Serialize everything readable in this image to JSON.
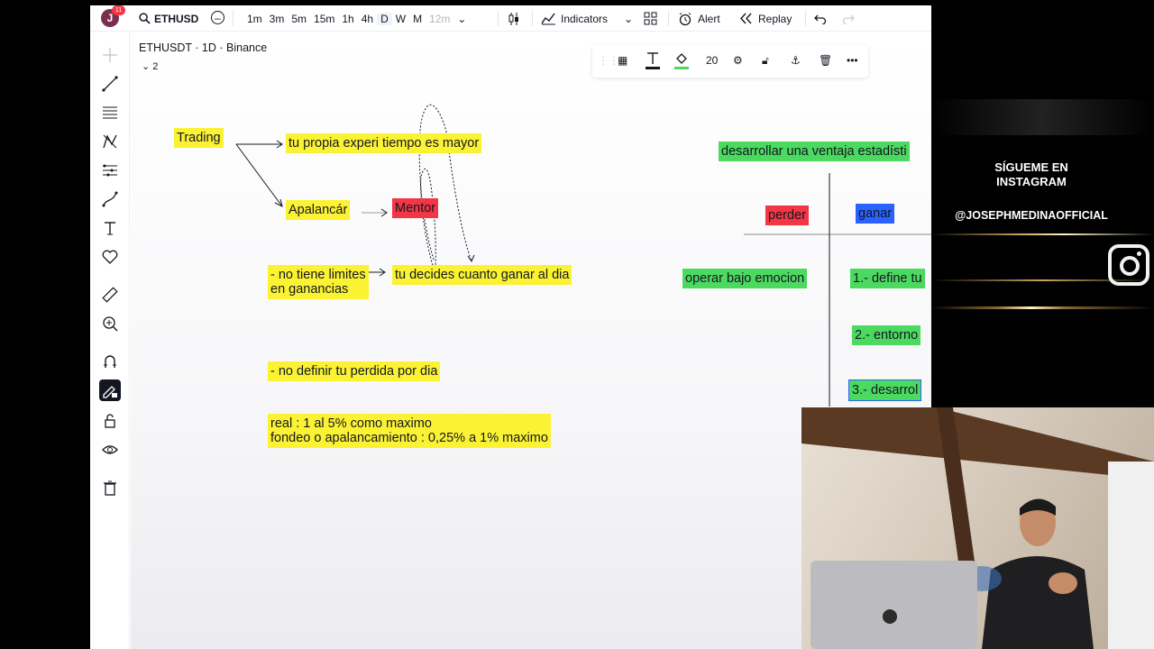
{
  "toolbar": {
    "avatar_letter": "J",
    "notification_count": "11",
    "symbol": "ETHUSD",
    "intervals": [
      "1m",
      "3m",
      "5m",
      "15m",
      "1h",
      "4h",
      "D",
      "W",
      "M",
      "12m"
    ],
    "active_interval": "D",
    "indicators_label": "Indicators",
    "alert_label": "Alert",
    "replay_label": "Replay"
  },
  "chart": {
    "legend": "ETHUSDT · 1D · Binance",
    "collapse_count": "2",
    "line_width_value": "20"
  },
  "notes": {
    "trading": "Trading",
    "tu_propia": "tu propia experi tiempo es mayor",
    "apalancar": "Apalancár",
    "mentor": "Mentor",
    "no_tiene": "- no tiene limites\nen ganancias",
    "tu_decides": "tu decides cuanto ganar al dia",
    "no_definir": "- no definir tu perdida por dia",
    "real": "real : 1 al 5% como maximo\nfondeo o apalancamiento : 0,25% a 1% maximo",
    "desarrollar": "desarrollar una ventaja estadísti",
    "perder": "perder",
    "ganar": "ganar",
    "operar": "operar bajo emocion",
    "define": "1.- define tu",
    "entorno": "2.- entorno",
    "desarrol": "3.- desarrol"
  },
  "promo": {
    "follow_text": "SÍGUEME EN\nINSTAGRAM",
    "handle": "@JOSEPHMEDINAOFFICIAL"
  },
  "colors": {
    "highlight_yellow": "#fbf233",
    "highlight_red": "#f23645",
    "highlight_green": "#4cd960",
    "highlight_blue": "#2962ff"
  }
}
